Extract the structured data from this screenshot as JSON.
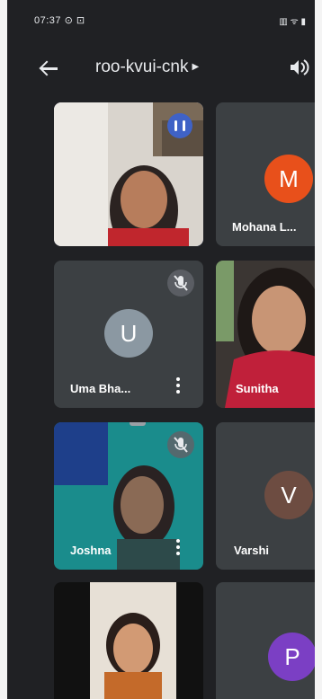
{
  "status_bar": {
    "time": "07:37 ⊙ ⊡",
    "right": "▥ ᯤ ▮"
  },
  "meeting": {
    "code": "roo-kvui-cnk"
  },
  "colors": {
    "background": "#202124",
    "tile": "#3c4043",
    "active_border": "#3f62c6"
  },
  "participants": [
    {
      "name": "",
      "video": true,
      "active_speaker": true
    },
    {
      "name": "Mohana L...",
      "initial": "M",
      "avatar_color": "#e8501b",
      "video": false
    },
    {
      "name": "Uma Bha...",
      "initial": "U",
      "avatar_color": "#8b98a2",
      "video": false,
      "muted": true
    },
    {
      "name": "Sunitha",
      "video": true
    },
    {
      "name": "Joshna",
      "video": true,
      "muted": true
    },
    {
      "name": "Varshi",
      "initial": "V",
      "avatar_color": "#6d4c41",
      "video": false
    },
    {
      "name": "",
      "video": true
    },
    {
      "name": "",
      "initial": "P",
      "avatar_color": "#7b3fc4",
      "video": false
    }
  ]
}
